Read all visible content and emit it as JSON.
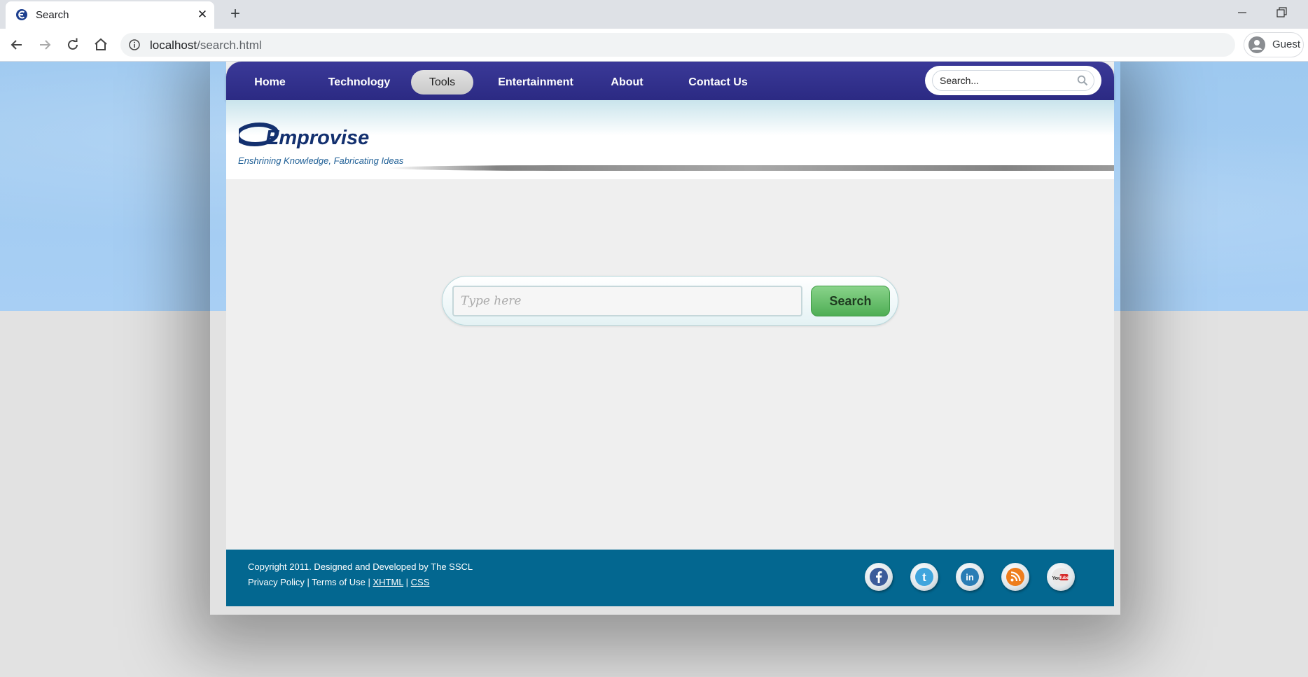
{
  "browser": {
    "tab_title": "Search",
    "url_host": "localhost",
    "url_path": "/search.html",
    "profile_label": "Guest"
  },
  "nav": {
    "items": [
      {
        "label": "Home",
        "active": false
      },
      {
        "label": "Technology",
        "active": false
      },
      {
        "label": "Tools",
        "active": true
      },
      {
        "label": "Entertainment",
        "active": false
      },
      {
        "label": "About",
        "active": false
      },
      {
        "label": "Contact Us",
        "active": false
      }
    ],
    "search_value": "Search..."
  },
  "header": {
    "logo_text": "Emprovise",
    "tagline": "Enshrining Knowledge, Fabricating Ideas"
  },
  "search": {
    "placeholder": "Type here",
    "button_label": "Search"
  },
  "footer": {
    "copyright": "Copyright 2011. Designed and Developed by The SSCL",
    "links": {
      "privacy": "Privacy Policy",
      "sep1": " | ",
      "terms": "Terms of Use",
      "sep2": " | ",
      "xhtml": "XHTML",
      "sep3": " | ",
      "css": "CSS"
    },
    "social_icons": [
      "facebook-icon",
      "twitter-icon",
      "linkedin-icon",
      "rss-icon",
      "youtube-icon"
    ]
  },
  "colors": {
    "nav_bg": "#2b2a83",
    "footer_bg": "#036790",
    "search_button": "#5cb85c",
    "sky": "#9ec9f0"
  }
}
